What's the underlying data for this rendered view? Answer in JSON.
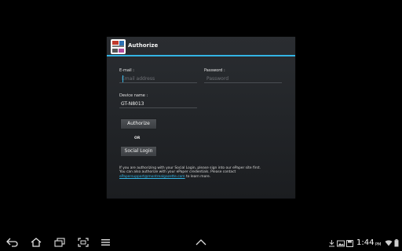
{
  "dialog": {
    "title": "Authorize",
    "email_label": "E-mail :",
    "email_placeholder": "Email address",
    "password_label": "Password :",
    "password_placeholder": "Password",
    "device_label": "Device name :",
    "device_value": "GT-N8013",
    "authorize_button": "Authorize",
    "or_text": "OR",
    "social_login_button": "Social Login",
    "info_line1": "If you are authorizing with your Social Login, please sign into our ePaper site first.",
    "info_line2": "You can also authorize with your ePaper credentials. Please contact",
    "info_link": "ePapersupport@montrealgazette.com",
    "info_suffix": " to learn more."
  },
  "status_bar": {
    "time": "1:44",
    "ampm": "PM"
  },
  "icons": {
    "back": "back-icon",
    "home": "home-icon",
    "recent": "recent-apps-icon",
    "screenshot": "screenshot-icon",
    "menu": "menu-icon",
    "collapse": "chevron-up-icon",
    "download": "download-icon",
    "image": "image-icon",
    "save": "save-icon",
    "wifi": "wifi-icon"
  },
  "colors": {
    "accent": "#33b5e5",
    "dialog_bg": "#1f2124",
    "background": "#000000"
  }
}
